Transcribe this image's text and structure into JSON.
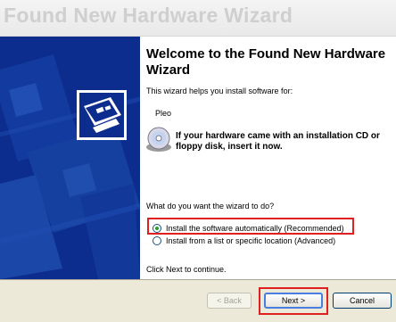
{
  "window": {
    "title": "Found New Hardware Wizard"
  },
  "content": {
    "heading": "Welcome to the Found New Hardware Wizard",
    "intro": "This wizard helps you install software for:",
    "device_name": "Pleo",
    "cd_prompt": "If your hardware came with an installation CD or floppy disk, insert it now.",
    "question": "What do you want the wizard to do?",
    "options": [
      {
        "label": "Install the software automatically (Recommended)",
        "selected": true
      },
      {
        "label": "Install from a list or specific location (Advanced)",
        "selected": false
      }
    ],
    "footer": "Click Next to continue."
  },
  "buttons": {
    "back": "< Back",
    "next": "Next >",
    "cancel": "Cancel"
  },
  "colors": {
    "sidebar": "#0d2d8e",
    "highlight": "#e02020",
    "button_bar": "#ece9d8"
  },
  "icons": {
    "hardware": "hardware-wizard-icon",
    "cd": "cd-disc-icon"
  }
}
